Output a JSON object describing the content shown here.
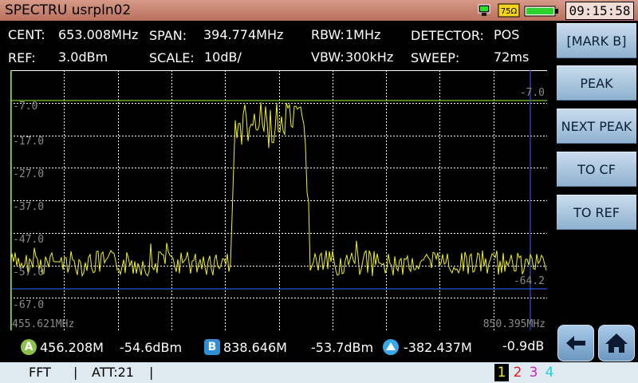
{
  "app": {
    "title": "SPECTRU usrpln02",
    "clock": "09:15:58",
    "battery_label": "75Ω"
  },
  "header": {
    "cent_label": "CENT:",
    "cent_value": "653.008MHz",
    "span_label": "SPAN:",
    "span_value": "394.774MHz",
    "rbw_label": "RBW:",
    "rbw_value": "1MHz",
    "detector_label": "DETECTOR:",
    "detector_value": "POS",
    "ref_label": "REF:",
    "ref_value": "3.0dBm",
    "scale_label": "SCALE:",
    "scale_value": "10dB/",
    "vbw_label": "VBW:",
    "vbw_value": "300kHz",
    "sweep_label": "SWEEP:",
    "sweep_value": "72ms"
  },
  "plot": {
    "y_labels": [
      "-7.0",
      "-17.0",
      "-27.0",
      "-37.0",
      "-47.0",
      "-57.0",
      "-67.0"
    ],
    "y_right_label": "-7.0",
    "marker_right_label": "-64.2",
    "x_start_label": "455.621MHz",
    "x_end_label": "850.395MHz",
    "colors": {
      "grid": "#ffffff",
      "trace": "#f0f020",
      "ref_line": "#7fcc3c",
      "marker_line": "#2a54d6"
    }
  },
  "buttons": {
    "mark_b": "[MARK B]",
    "peak": "PEAK",
    "next_peak": "NEXT PEAK",
    "to_cf": "TO CF",
    "to_ref": "TO REF",
    "back_icon": "left-arrow-icon",
    "home_icon": "home-icon"
  },
  "markers": {
    "a_badge": "A",
    "a_freq": "456.208M",
    "a_level": "-54.6dBm",
    "b_badge": "B",
    "b_freq": "838.646M",
    "b_level": "-53.7dBm",
    "delta_freq": "-382.437M",
    "delta_level": "-0.9dB"
  },
  "bottom": {
    "mode": "FFT",
    "sep1": "|",
    "att": "ATT:21",
    "sep2": "|",
    "traces": [
      "1",
      "2",
      "3",
      "4"
    ]
  }
}
